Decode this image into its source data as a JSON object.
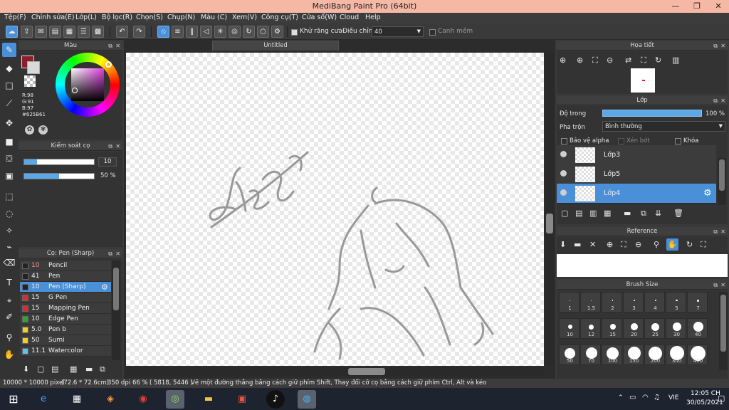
{
  "window": {
    "title": "MediBang Paint Pro (64bit)"
  },
  "menu": [
    "Tệp(F)",
    "Chỉnh sửa(E)",
    "Lớp(L)",
    "Bộ lọc(R)",
    "Chọn(S)",
    "Chụp(N)",
    "Màu (C)",
    "Xem(V)",
    "Công cụ(T)",
    "Cửa sổ(W)",
    "Cloud",
    "Help"
  ],
  "toolbar": {
    "antialias_label": "Khử răng cưa",
    "adjust_label": "Điều chỉnh",
    "adjust_value": "40",
    "margin_label": "Canh mềm"
  },
  "document": {
    "tab": "Untitled"
  },
  "color_panel": {
    "title": "Màu",
    "r": "R:98",
    "g": "G:91",
    "b": "B:97",
    "hex": "#625B61",
    "primary": "#8b1f2a"
  },
  "brush_control": {
    "title": "Kiểm soát cọ",
    "size": "10",
    "opacity": "50 %"
  },
  "brush_list": {
    "title": "Cọ: Pen (Sharp)",
    "items": [
      {
        "size": "10",
        "name": "Pencil",
        "color": "#222222"
      },
      {
        "size": "41",
        "name": "Pen",
        "color": "#222222"
      },
      {
        "size": "10",
        "name": "Pen (Sharp)",
        "color": "#222222"
      },
      {
        "size": "15",
        "name": "G Pen",
        "color": "#e02a2a"
      },
      {
        "size": "15",
        "name": "Mapping Pen",
        "color": "#e02a2a"
      },
      {
        "size": "10",
        "name": "Edge Pen",
        "color": "#2aa82a"
      },
      {
        "size": "5.0",
        "name": "Pen b",
        "color": "#f0d020"
      },
      {
        "size": "50",
        "name": "Sumi",
        "color": "#f0d020"
      },
      {
        "size": "11.1",
        "name": "Watercolor",
        "color": "#60c0f0"
      }
    ]
  },
  "navigator": {
    "title": "Họa tiết"
  },
  "layers": {
    "title": "Lớp",
    "opacity_label": "Độ trong",
    "opacity_value": "100 %",
    "blend_label": "Pha trộn",
    "blend_value": "Bình thường",
    "protect_alpha": "Bảo vệ alpha",
    "clipping": "Xén bớt",
    "lock": "Khóa",
    "items": [
      {
        "name": "Lớp3"
      },
      {
        "name": "Lớp5"
      },
      {
        "name": "Lớp4"
      }
    ]
  },
  "reference": {
    "title": "Reference"
  },
  "brush_size": {
    "title": "Brush Size",
    "sizes": [
      "1",
      "1.5",
      "2",
      "3",
      "4",
      "5",
      "7",
      "10",
      "12",
      "15",
      "20",
      "25",
      "30",
      "40",
      "50",
      "70",
      "100",
      "150",
      "200",
      "300",
      "400"
    ]
  },
  "status": {
    "canvas": "10000 * 10000 pixel",
    "physical": "(72.6 * 72.6cm)",
    "dpi": "350 dpi",
    "zoom": "66 %",
    "coords": "( 5818, 5446 )",
    "hint": "Vẽ một đường thẳng bằng cách giữ phím Shift, Thay đổi cỡ cọ bằng cách giữ phím Ctrl, Alt và kéo"
  },
  "taskbar": {
    "time": "12:05 CH",
    "date": "30/05/2021",
    "lang": "VIE"
  }
}
